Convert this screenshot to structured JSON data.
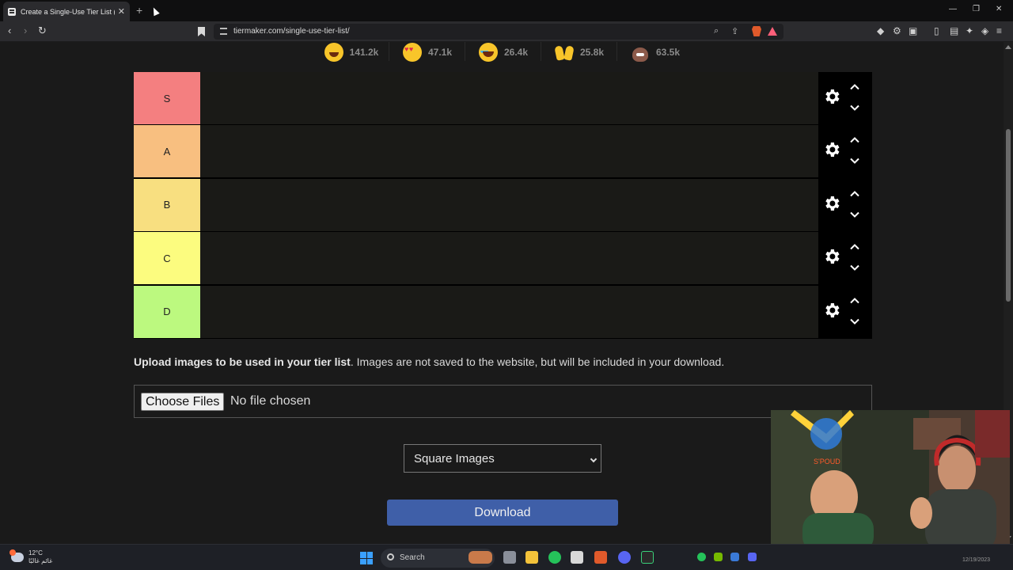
{
  "browser": {
    "tab_title": "Create a Single-Use Tier List (Pri...",
    "tab_close": "✕",
    "new_tab": "+",
    "url": "tiermaker.com/single-use-tier-list/",
    "nav": {
      "back": "‹",
      "forward": "›",
      "reload": "↻"
    },
    "window": {
      "minimize": "—",
      "restore": "❐",
      "close": "✕"
    },
    "icons": {
      "zoom": "⌕",
      "share": "⇪",
      "ext1": "◆",
      "ext2": "⚙",
      "ext3": "▣",
      "sidebar": "▯",
      "wallet": "▤",
      "leo": "✦",
      "vpn": "◈",
      "menu": "≡"
    }
  },
  "reactions": [
    {
      "emoji": "grinning-face-icon",
      "count": "141.2k"
    },
    {
      "emoji": "heart-eyes-face-icon",
      "count": "47.1k"
    },
    {
      "emoji": "laughing-tears-face-icon",
      "count": "26.4k"
    },
    {
      "emoji": "raised-hands-icon",
      "count": "25.8k"
    },
    {
      "emoji": "poop-icon",
      "count": "63.5k"
    }
  ],
  "tiers": [
    {
      "label": "S",
      "color": "#f47f80"
    },
    {
      "label": "A",
      "color": "#f8bf80"
    },
    {
      "label": "B",
      "color": "#f8df80"
    },
    {
      "label": "C",
      "color": "#fcfc7f"
    },
    {
      "label": "D",
      "color": "#bcf97f"
    }
  ],
  "upload": {
    "bold_text": "Upload images to be used in your tier list",
    "rest_text": ". Images are not saved to the website, but will be included in your download.",
    "choose_button": "Choose Files",
    "no_file": "No file chosen"
  },
  "image_shape_select": {
    "selected": "Square Images"
  },
  "download_button": "Download",
  "taskbar": {
    "weather_temp": "12°C",
    "weather_desc": "غائم غالبًا",
    "search_label": "Search",
    "clock_date": "12/19/2023"
  },
  "colors": {
    "accent_download": "#3f5fa8",
    "page_bg": "#1a1a1a",
    "tier_drop_bg": "#1a1a17"
  }
}
